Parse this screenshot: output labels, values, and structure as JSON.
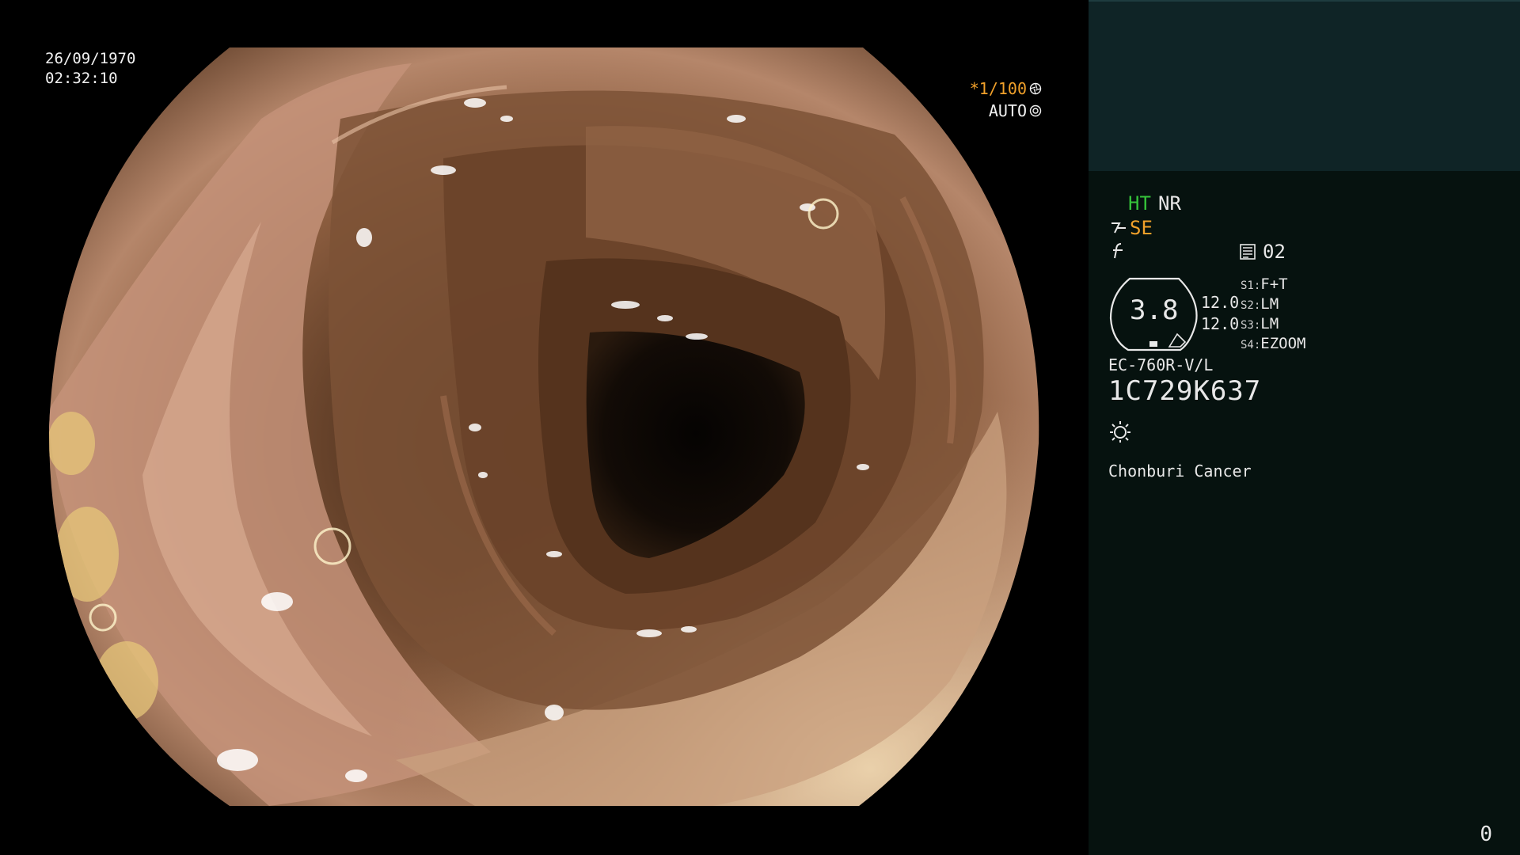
{
  "overlay": {
    "date": "26/09/1970",
    "time": "02:32:10",
    "shutter": "*1/100",
    "iris": "AUTO"
  },
  "panel": {
    "ht_label": "HT",
    "nr_label": "NR",
    "se_label": "SE",
    "memory_value": "02",
    "gauge_value": "3.8",
    "gauge_right_1": "12.0",
    "gauge_right_2": "12.0",
    "switches": [
      {
        "key": "S1:",
        "value": "F+T"
      },
      {
        "key": "S2:",
        "value": "LM"
      },
      {
        "key": "S3:",
        "value": "LM"
      },
      {
        "key": "S4:",
        "value": "EZOOM"
      }
    ],
    "scope_model": "EC-760R-V/L",
    "serial": "1C729K637",
    "institution": "Chonburi Cancer",
    "counter": "0"
  },
  "icons": {
    "shutter_icon": "aperture-icon",
    "iris_icon": "iris-icon",
    "se_icon": "structure-enhance-icon",
    "f_icon": "freeze-icon",
    "memory_icon": "memory-card-icon",
    "light_icon": "light-source-icon"
  },
  "colors": {
    "status_green": "#35c43a",
    "status_orange": "#f0a02a",
    "panel_bg": "#06120f",
    "panel_top_bg": "#0f2426"
  }
}
